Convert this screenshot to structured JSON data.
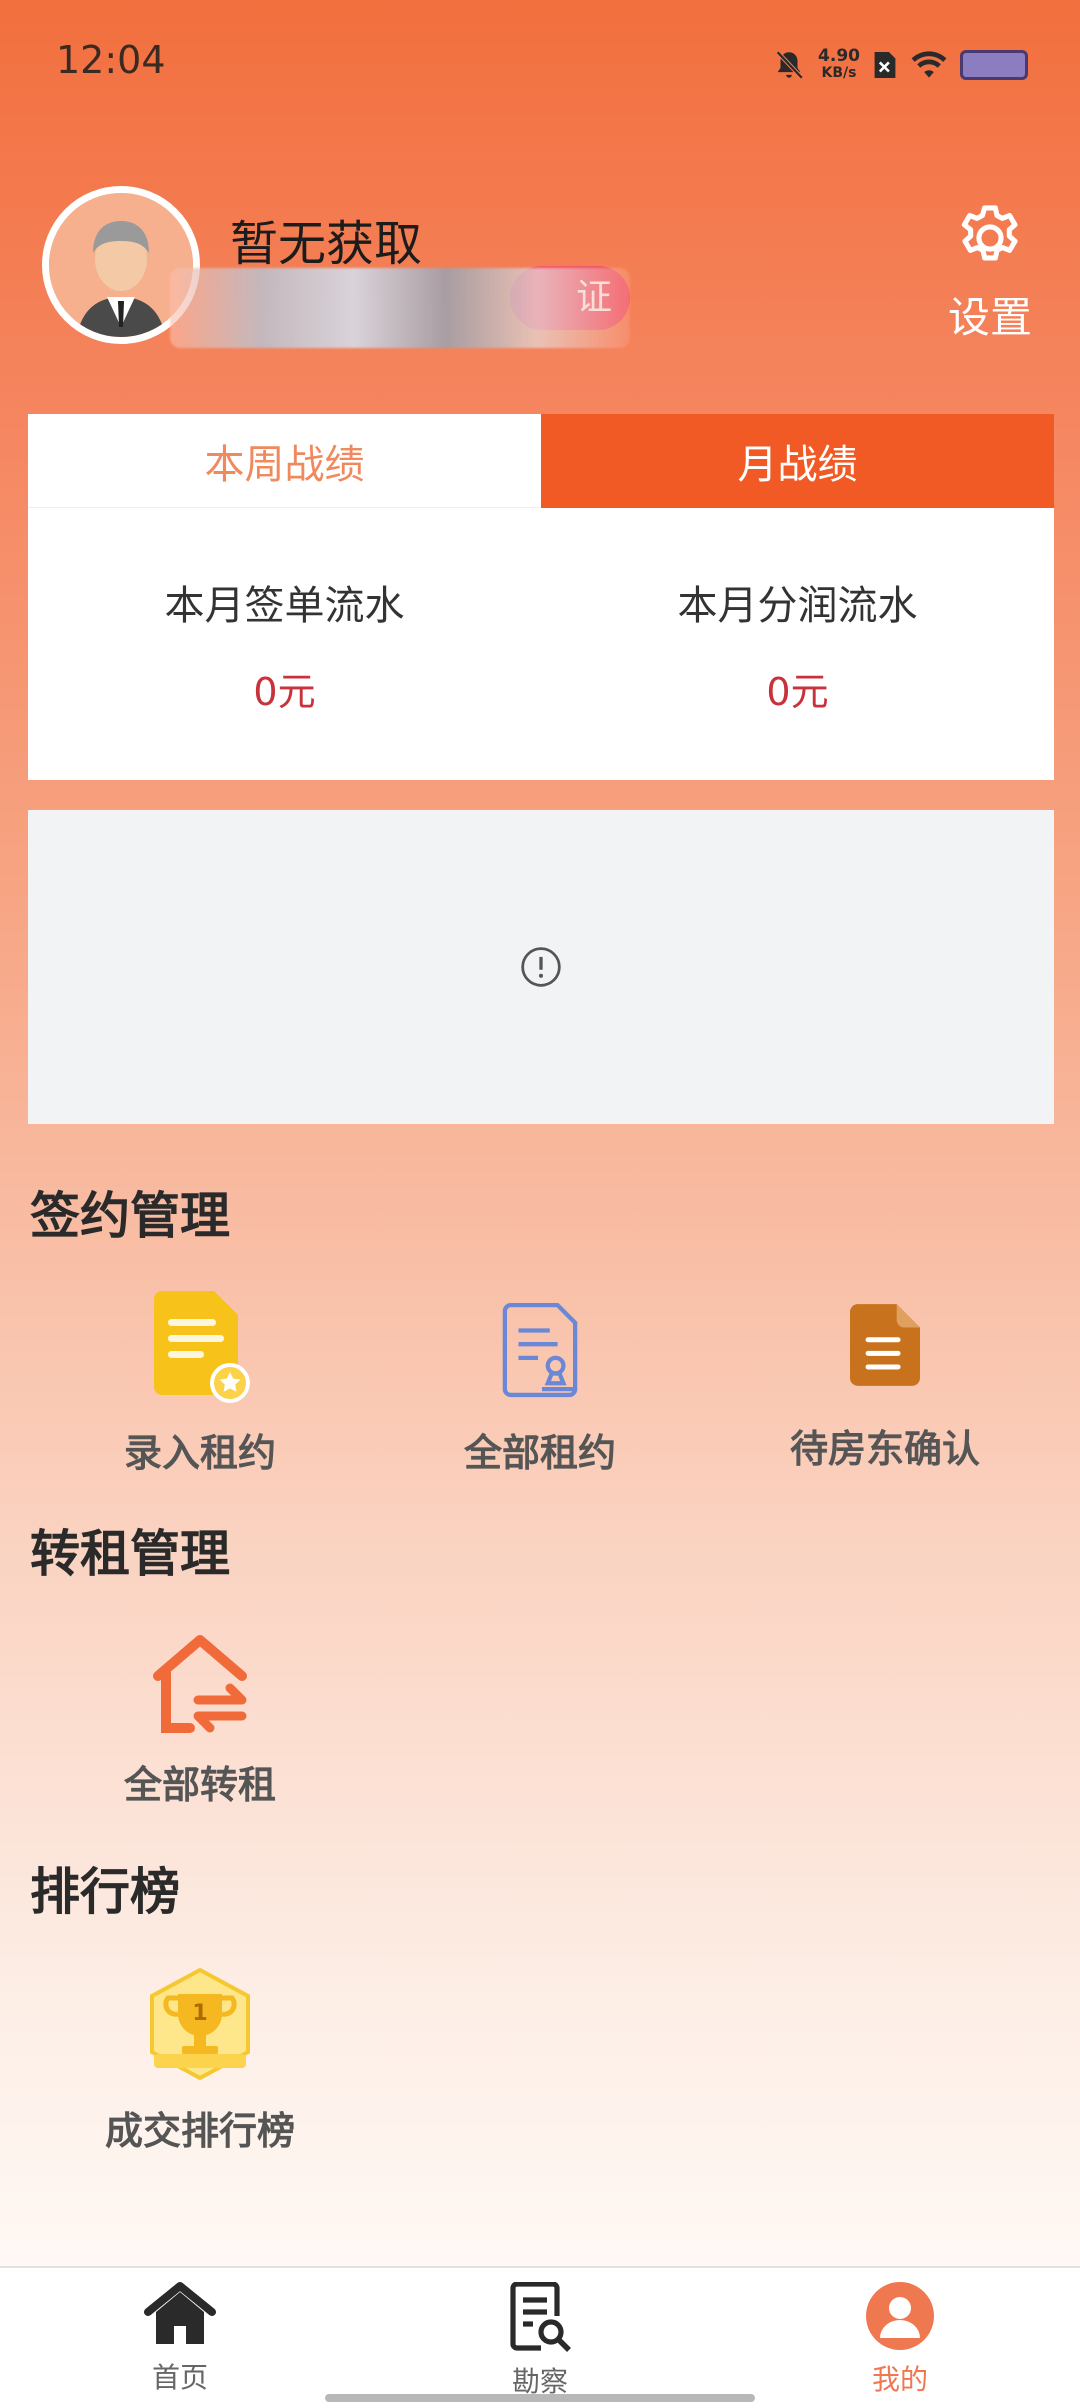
{
  "status_bar": {
    "time": "12:04",
    "net_speed_value": "4.90",
    "net_speed_unit": "KB/s",
    "icons": [
      "mute-bell-icon",
      "no-sim-icon",
      "wifi-icon",
      "battery-icon"
    ]
  },
  "profile": {
    "name": "暂无获取",
    "cert_tag": "证",
    "settings_label": "设置"
  },
  "stats": {
    "tabs": [
      {
        "label": "本周战绩",
        "active": false
      },
      {
        "label": "月战绩",
        "active": true
      }
    ],
    "items": [
      {
        "label": "本月签单流水",
        "value": "0元"
      },
      {
        "label": "本月分润流水",
        "value": "0元"
      }
    ]
  },
  "sections": {
    "signing": {
      "title": "签约管理",
      "items": [
        {
          "label": "录入租约",
          "icon": "document-star-icon"
        },
        {
          "label": "全部租约",
          "icon": "contract-stamp-icon"
        },
        {
          "label": "待房东确认",
          "icon": "document-lines-icon"
        }
      ]
    },
    "sublet": {
      "title": "转租管理",
      "items": [
        {
          "label": "全部转租",
          "icon": "house-swap-icon"
        }
      ]
    },
    "ranking": {
      "title": "排行榜",
      "items": [
        {
          "label": "成交排行榜",
          "icon": "trophy-icon"
        }
      ]
    }
  },
  "bottom_nav": [
    {
      "label": "首页",
      "icon": "home-icon",
      "active": false
    },
    {
      "label": "勘察",
      "icon": "survey-icon",
      "active": false
    },
    {
      "label": "我的",
      "icon": "profile-icon",
      "active": true
    }
  ],
  "colors": {
    "accent": "#f15a24",
    "value_red": "#c8323a",
    "active_nav": "#f07850"
  }
}
